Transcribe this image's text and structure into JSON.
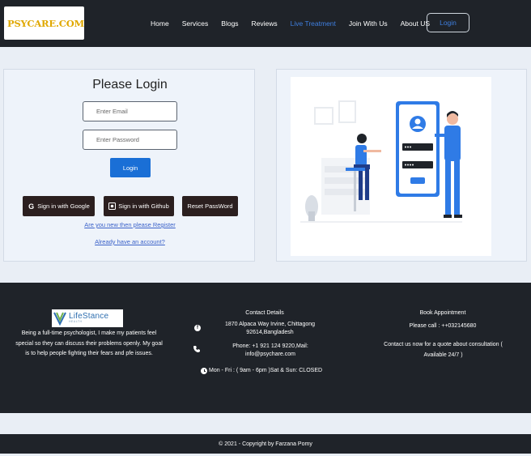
{
  "brand": {
    "logo_text": "PSYCARE.COM"
  },
  "nav": {
    "links": [
      "Home",
      "Services",
      "Blogs",
      "Reviews",
      "Live Treatment",
      "Join With Us",
      "About US"
    ],
    "active_index": 4,
    "login_label": "Login"
  },
  "login": {
    "title": "Please Login",
    "email_placeholder": "Enter Email",
    "password_placeholder": "Enter Password",
    "submit_label": "Login",
    "google_label": "Sign in with Google",
    "github_label": "Sign in with Github",
    "reset_label": "Reset PassWord",
    "register_link": "Are you new then please Register",
    "existing_link": "Already have an account?"
  },
  "footer": {
    "partner_logo": {
      "main": "LifeStance",
      "sub": "HEALTH"
    },
    "about": "Being a full-time psychologist, I make my patients feel special so they can discuss their problems openly. My goal is to help people fighting their fears and pfe issues.",
    "contact_title": "Contact Details",
    "address": "1870 Alpaca Way Irvine, Chittagong 92614,Bangladesh",
    "phone": "Phone: +1 921 124 9220,Mail: info@psychare.com",
    "hours": "Mon - Fri : ( 9am - 6pm )Sat & Sun: CLOSED",
    "book_title": "Book Appointment",
    "book_call": "Please call : ++032145680",
    "book_note": "Contact us now for a quote about consultation ( Available 24/7 )"
  },
  "copyright": "© 2021 - Copyright by Farzana Pomy",
  "colors": {
    "dark": "#1f2329",
    "accent": "#1a6fd6",
    "nav_active": "#3f7fe0",
    "logo_gold": "#e0a800",
    "page_bg": "#e9eef5"
  }
}
